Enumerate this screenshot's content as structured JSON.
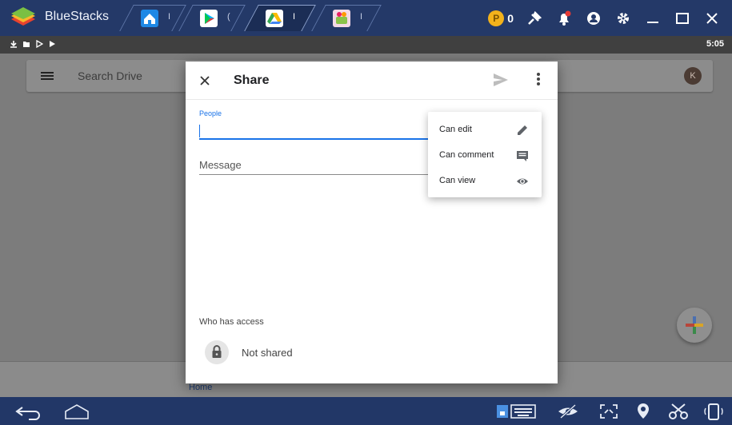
{
  "titlebar": {
    "app_name": "BlueStacks",
    "tabs": [
      {
        "icon": "home-icon",
        "label": "I"
      },
      {
        "icon": "play-store-icon",
        "label": "("
      },
      {
        "icon": "google-drive-icon",
        "label": "I"
      },
      {
        "icon": "app-icon",
        "label": "I"
      }
    ],
    "coins": "0",
    "right_icons": [
      "pin-icon",
      "notification-icon",
      "account-icon",
      "settings-icon",
      "minimize-icon",
      "maximize-icon",
      "close-icon"
    ]
  },
  "statusbar": {
    "time": "5:05",
    "icons": [
      "download-icon",
      "folder-icon",
      "play-icon",
      "play-store-icon"
    ]
  },
  "drive": {
    "search_placeholder": "Search Drive",
    "account_initial": "K",
    "bottom_nav_label": "Home"
  },
  "share_dialog": {
    "title": "Share",
    "people_label": "People",
    "message_placeholder": "Message",
    "who_has_access_label": "Who has access",
    "access_status": "Not shared"
  },
  "permission_menu": {
    "items": [
      {
        "label": "Can edit",
        "icon": "pencil-icon"
      },
      {
        "label": "Can comment",
        "icon": "comment-icon"
      },
      {
        "label": "Can view",
        "icon": "eye-icon"
      }
    ]
  },
  "navbar": {
    "icons": [
      "back-icon",
      "home-icon",
      "keyboard-icon",
      "eye-slash-icon",
      "fullscreen-icon",
      "location-icon",
      "scissors-icon",
      "rotate-icon"
    ]
  },
  "colors": {
    "titlebar_bg": "#243968",
    "statusbar_bg": "#404040",
    "accent_blue": "#1a73e8",
    "coin": "#f3b21b"
  }
}
